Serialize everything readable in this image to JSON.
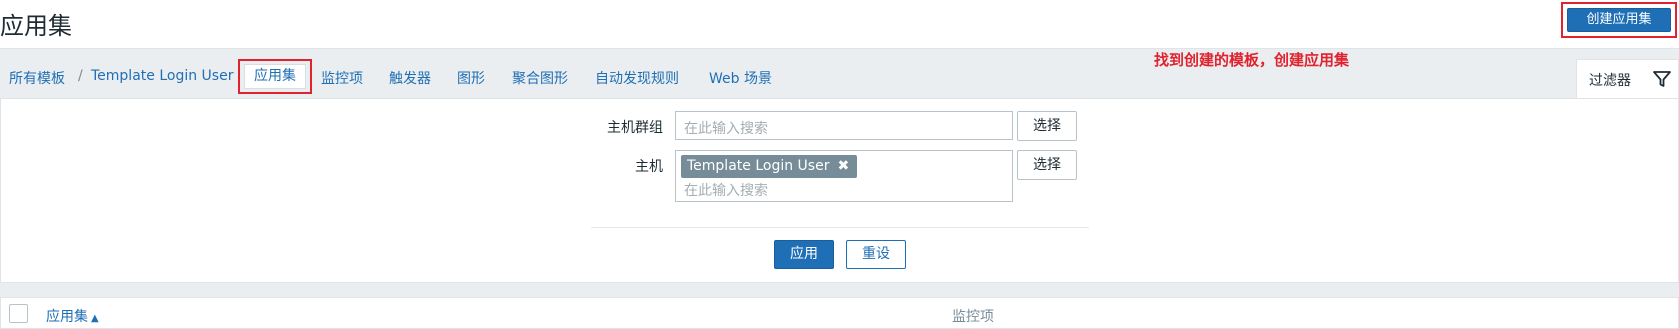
{
  "header": {
    "title": "应用集",
    "create_button": "创建应用集"
  },
  "breadcrumb": {
    "all_templates": "所有模板",
    "separator": "/",
    "template": "Template Login User"
  },
  "tabs": {
    "applications": "应用集",
    "items": "监控项",
    "triggers": "触发器",
    "graphs": "图形",
    "screens": "聚合图形",
    "discovery": "自动发现规则",
    "web": "Web 场景"
  },
  "annotation": "找到创建的模板，创建应用集",
  "filter": {
    "tab_label": "过滤器",
    "host_group_label": "主机群组",
    "host_group_placeholder": "在此输入搜索",
    "host_label": "主机",
    "host_tag": "Template Login User",
    "host_placeholder": "在此输入搜索",
    "select_label": "选择",
    "apply_label": "应用",
    "reset_label": "重设"
  },
  "table": {
    "col_application": "应用集",
    "sort_indicator": "▲",
    "col_items": "监控项"
  },
  "colors": {
    "accent": "#1e6fb5",
    "annotation_red": "#e0232e",
    "tag_gray": "#768d99"
  },
  "icons": [
    "filter-icon",
    "remove-tag-icon",
    "sort-asc-icon"
  ]
}
